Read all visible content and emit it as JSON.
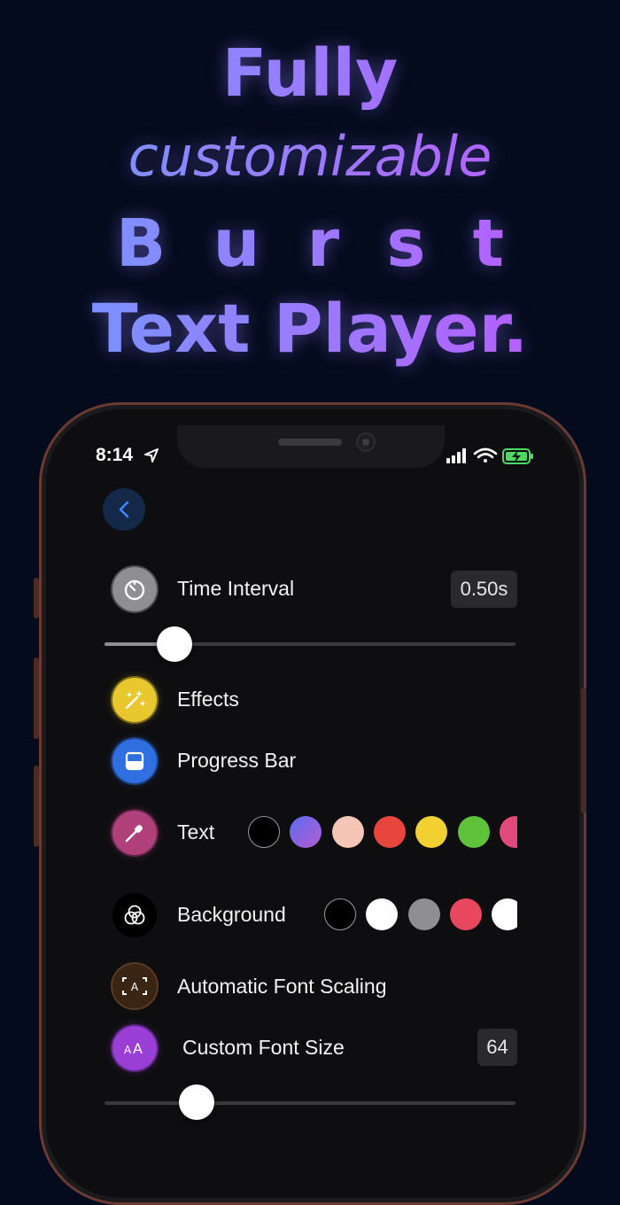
{
  "headline": {
    "line1": "Fully",
    "line2": "customizable",
    "line3": "Burst",
    "line4": "Text Player."
  },
  "status_bar": {
    "time": "8:14",
    "icons": [
      "location-arrow-icon",
      "cellular-signal-icon",
      "wifi-icon",
      "battery-charging-icon"
    ]
  },
  "nav": {
    "back_icon": "chevron-left-icon"
  },
  "settings": {
    "time_interval": {
      "label": "Time Interval",
      "value": "0.50s",
      "slider_fraction": 0.17
    },
    "effects": {
      "label": "Effects"
    },
    "progress_bar": {
      "label": "Progress Bar"
    },
    "text": {
      "label": "Text",
      "colors": [
        "#000000",
        "gradient-blue-purple",
        "#f5c6b8",
        "#e8453c",
        "#f2d032",
        "#5ec23a",
        "#e0497a"
      ]
    },
    "background": {
      "label": "Background",
      "colors": [
        "#000000",
        "#ffffff",
        "#8e8e93",
        "#e8475f",
        "#ffffff"
      ]
    },
    "auto_font_scaling": {
      "label": "Automatic Font Scaling"
    },
    "custom_font_size": {
      "label": "Custom Font Size",
      "value": "64"
    }
  },
  "colors": {
    "accent_blue": "#2f6fe0",
    "effects_yellow": "#e8c82e",
    "text_pink": "#b0407a",
    "font_purple": "#9a3fd6",
    "font_scaling_brown": "#3a2414"
  }
}
